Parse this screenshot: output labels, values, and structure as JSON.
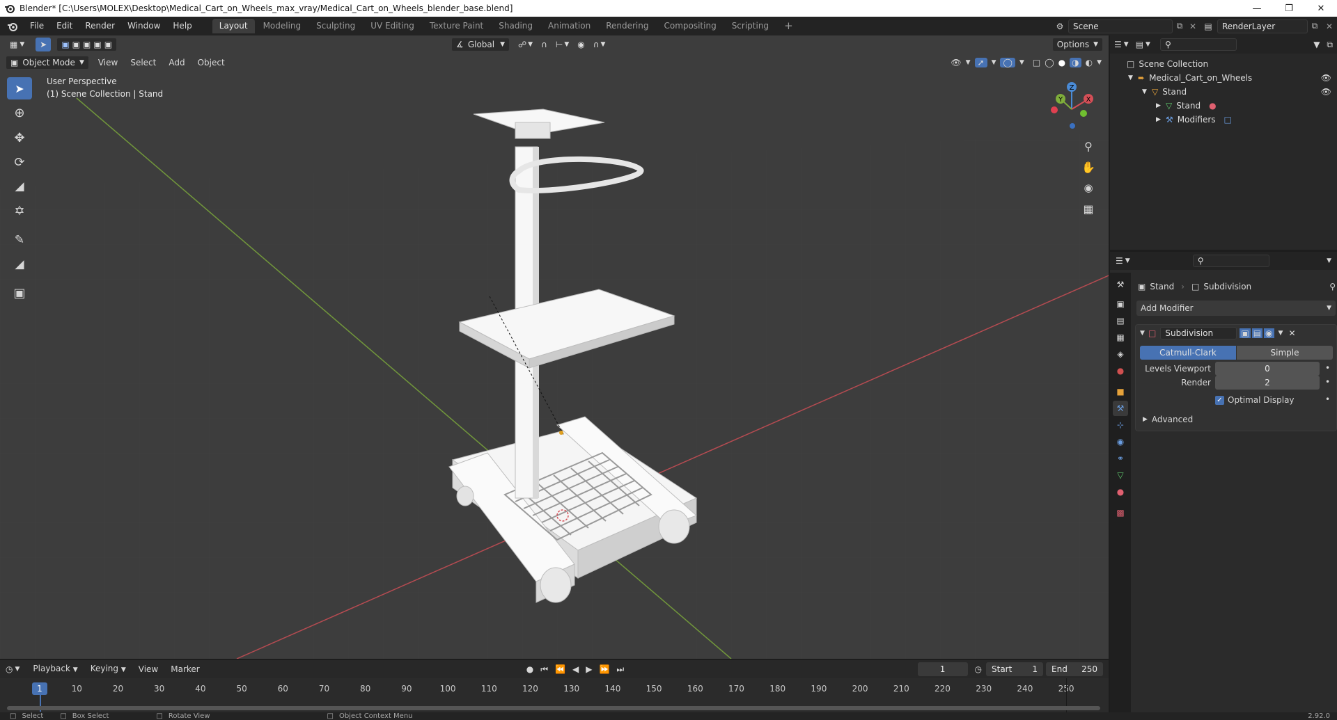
{
  "window": {
    "title": "Blender* [C:\\Users\\MOLEX\\Desktop\\Medical_Cart_on_Wheels_max_vray/Medical_Cart_on_Wheels_blender_base.blend]"
  },
  "menu": {
    "items": [
      "File",
      "Edit",
      "Render",
      "Window",
      "Help"
    ]
  },
  "workspaces": {
    "tabs": [
      "Layout",
      "Modeling",
      "Sculpting",
      "UV Editing",
      "Texture Paint",
      "Shading",
      "Animation",
      "Rendering",
      "Compositing",
      "Scripting"
    ],
    "active": "Layout",
    "add": "+"
  },
  "scene": {
    "name": "Scene",
    "render_layer": "RenderLayer"
  },
  "viewport": {
    "mode": "Object Mode",
    "menus": [
      "View",
      "Select",
      "Add",
      "Object"
    ],
    "transform_orientation": "Global",
    "options_label": "Options",
    "overlay_line1": "User Perspective",
    "overlay_line2": "(1) Scene Collection | Stand",
    "gizmo_axes": {
      "x": "X",
      "y": "Y",
      "z": "Z"
    }
  },
  "outliner": {
    "root": "Scene Collection",
    "items": [
      {
        "label": "Medical_Cart_on_Wheels",
        "depth": 1
      },
      {
        "label": "Stand",
        "depth": 2
      },
      {
        "label": "Stand",
        "depth": 3
      },
      {
        "label": "Modifiers",
        "depth": 3
      }
    ]
  },
  "properties": {
    "breadcrumb_object": "Stand",
    "breadcrumb_modifier": "Subdivision",
    "add_modifier": "Add Modifier",
    "modifier": {
      "name": "Subdivision",
      "type_options": [
        "Catmull-Clark",
        "Simple"
      ],
      "type_selected": "Catmull-Clark",
      "levels_viewport_label": "Levels Viewport",
      "levels_viewport": "0",
      "render_label": "Render",
      "render": "2",
      "optimal_display_label": "Optimal Display",
      "optimal_display": true,
      "advanced_label": "Advanced"
    }
  },
  "timeline": {
    "menus": [
      "Playback",
      "Keying",
      "View",
      "Marker"
    ],
    "current_frame": "1",
    "start_label": "Start",
    "start": "1",
    "end_label": "End",
    "end": "250",
    "ticks": [
      "10",
      "20",
      "30",
      "40",
      "50",
      "60",
      "70",
      "80",
      "90",
      "100",
      "110",
      "120",
      "130",
      "140",
      "150",
      "160",
      "170",
      "180",
      "190",
      "200",
      "210",
      "220",
      "230",
      "240",
      "250"
    ],
    "playhead": "1"
  },
  "statusbar": {
    "items": [
      "Select",
      "Box Select",
      "Rotate View",
      "Object Context Menu"
    ],
    "version": "2.92.0"
  },
  "colors": {
    "accent": "#4772b3",
    "viewport_bg": "#3d3d3d",
    "x_axis": "#d54f57",
    "y_axis": "#7fae3b",
    "z_axis": "#4a8bd6"
  }
}
